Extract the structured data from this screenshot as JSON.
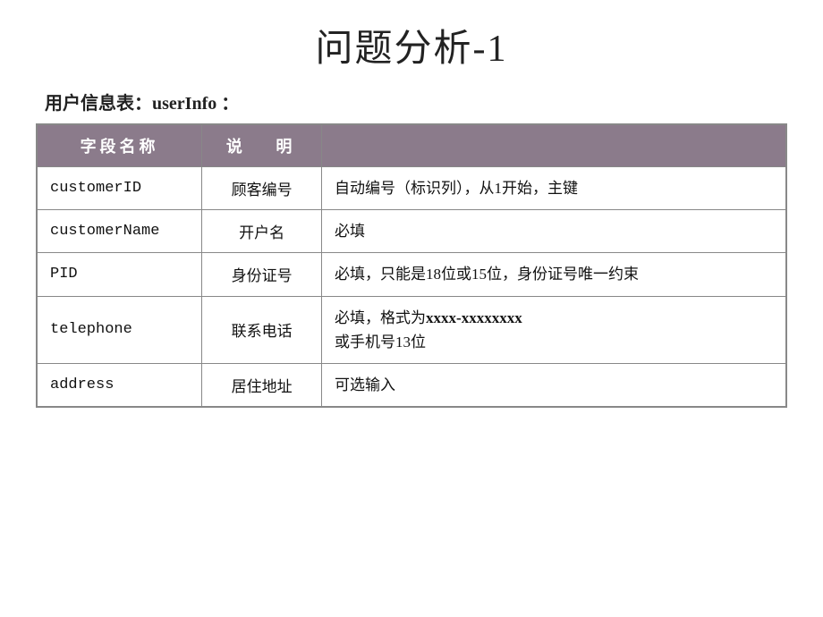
{
  "page": {
    "title": "问题分析-1",
    "subtitle": "用户信息表：userInfo ："
  },
  "table": {
    "headers": [
      "字段名称",
      "说   明",
      ""
    ],
    "header_col1": "字段名称",
    "header_col2": "说   明",
    "header_col3": "",
    "rows": [
      {
        "field": "customerID",
        "description": "顾客编号",
        "details": "自动编号（标识列），从1开始，主键"
      },
      {
        "field": "customerName",
        "description": "开户名",
        "details": "必填"
      },
      {
        "field": "PID",
        "description": "身份证号",
        "details": "必填，只能是18位或15位，身份证号唯一约束"
      },
      {
        "field": "telephone",
        "description": "联系电话",
        "details": "必填，格式为xxxx-xxxxxxxx或手机号13位"
      },
      {
        "field": "address",
        "description": "居住地址",
        "details": "可选输入"
      }
    ]
  }
}
